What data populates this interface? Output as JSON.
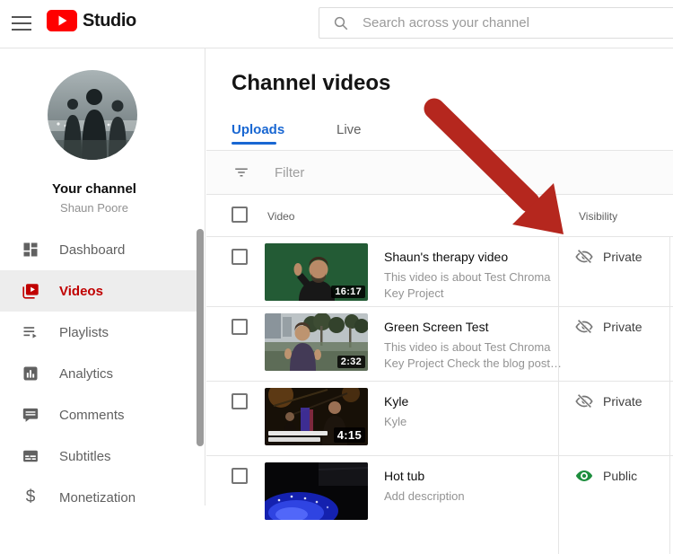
{
  "topbar": {
    "logo_text": "Studio",
    "search_placeholder": "Search across your channel",
    "icons": {
      "menu": "hamburger-menu-icon",
      "logo": "youtube-play-icon",
      "search": "search-icon"
    }
  },
  "sidebar": {
    "channel_label": "Your channel",
    "channel_owner": "Shaun Poore",
    "items": [
      {
        "label": "Dashboard",
        "icon": "dashboard-icon",
        "active": false
      },
      {
        "label": "Videos",
        "icon": "videos-icon",
        "active": true
      },
      {
        "label": "Playlists",
        "icon": "playlists-icon",
        "active": false
      },
      {
        "label": "Analytics",
        "icon": "analytics-icon",
        "active": false
      },
      {
        "label": "Comments",
        "icon": "comments-icon",
        "active": false
      },
      {
        "label": "Subtitles",
        "icon": "subtitles-icon",
        "active": false
      },
      {
        "label": "Monetization",
        "icon": "monetization-icon",
        "active": false
      }
    ]
  },
  "main": {
    "page_title": "Channel videos",
    "tabs": [
      {
        "label": "Uploads",
        "active": true
      },
      {
        "label": "Live",
        "active": false
      }
    ],
    "filter_placeholder": "Filter",
    "table": {
      "headers": {
        "video": "Video",
        "visibility": "Visibility"
      },
      "rows": [
        {
          "title": "Shaun's therapy video",
          "description": "This video is about Test Chroma Key Project",
          "duration": "16:17",
          "visibility": "Private",
          "visibility_icon": "eye-off-icon",
          "thumbnail": "man-waving-green-screen"
        },
        {
          "title": "Green Screen Test",
          "description": "This video is about Test Chroma Key Project Check the blog post…",
          "duration": "2:32",
          "visibility": "Private",
          "visibility_icon": "eye-off-icon",
          "thumbnail": "man-outdoors-palm-trees"
        },
        {
          "title": "Kyle",
          "description": "Kyle",
          "duration": "4:15",
          "visibility": "Private",
          "visibility_icon": "eye-off-icon",
          "thumbnail": "dark-concert-scene"
        },
        {
          "title": "Hot tub",
          "description": "Add description",
          "duration": "",
          "visibility": "Public",
          "visibility_icon": "eye-public-icon",
          "thumbnail": "hot-tub-blue-glow"
        }
      ]
    }
  },
  "annotation": {
    "name": "red-arrow",
    "color": "#b5271e",
    "points_to": "Visibility column"
  },
  "colors": {
    "accent_blue": "#1967d2",
    "youtube_red": "#ff0000",
    "videos_red": "#c00000",
    "public_green": "#1e8e3e",
    "private_gray": "#757575"
  }
}
